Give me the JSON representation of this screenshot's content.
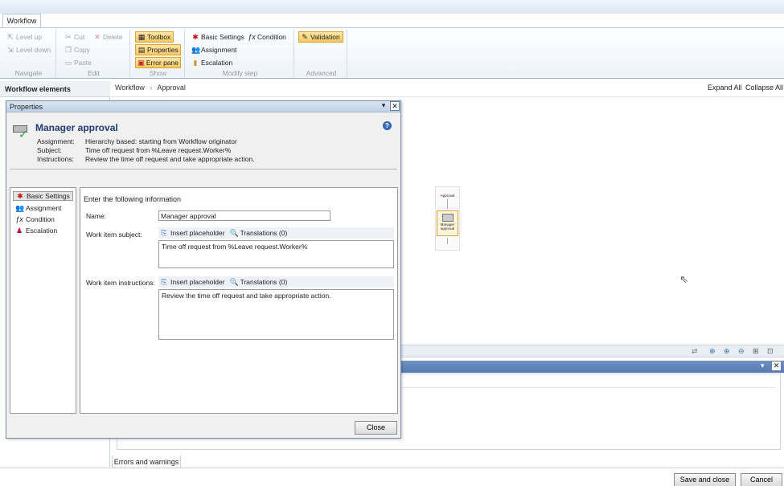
{
  "tabs": {
    "workflow": "Workflow"
  },
  "ribbon": {
    "navigate": {
      "label": "Navigate",
      "level_up": "Level up",
      "level_down": "Level down"
    },
    "edit": {
      "label": "Edit",
      "cut": "Cut",
      "delete": "Delete",
      "copy": "Copy",
      "paste": "Paste"
    },
    "show": {
      "label": "Show",
      "toolbox": "Toolbox",
      "properties": "Properties",
      "error_pane": "Error pane"
    },
    "modify": {
      "label": "Modify step",
      "basic_settings": "Basic Settings",
      "condition": "Condition",
      "assignment": "Assignment",
      "escalation": "Escalation"
    },
    "advanced": {
      "label": "Advanced",
      "validation": "Validation"
    }
  },
  "left_pane": {
    "title": "Workflow elements"
  },
  "breadcrumb": {
    "root": "Workflow",
    "sep": "›",
    "current": "Approval"
  },
  "canvas": {
    "expand_all": "Expand All",
    "collapse_all": "Collapse All",
    "mini_approval": "Approval",
    "mini_manager": "Manager approval"
  },
  "bottom": {
    "errors_tab": "Errors and warnings",
    "save_close": "Save and close",
    "cancel": "Cancel"
  },
  "dialog": {
    "title": "Properties",
    "heading": "Manager approval",
    "assignment_label": "Assignment:",
    "assignment_value": "Hierarchy based: starting from Workflow originator",
    "subject_label": "Subject:",
    "subject_value": "Time off request from %Leave request.Worker%",
    "instructions_label": "Instructions:",
    "instructions_value": "Review the time off request and take appropriate action.",
    "nav": {
      "basic_settings": "Basic Settings",
      "assignment": "Assignment",
      "condition": "Condition",
      "escalation": "Escalation"
    },
    "form": {
      "prompt": "Enter the following information",
      "name_label": "Name:",
      "name_value": "Manager approval",
      "subject_label": "Work item subject:",
      "subject_value": "Time off request from %Leave request.Worker%",
      "instructions_label": "Work item instructions:",
      "instructions_value": "Review the time off request and take appropriate action.",
      "insert_placeholder": "Insert placeholder",
      "translations": "Translations (0)"
    },
    "close": "Close"
  }
}
